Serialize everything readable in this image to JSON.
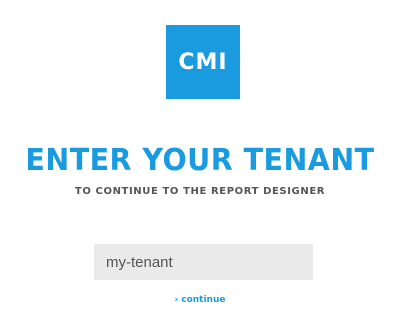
{
  "logo": {
    "text": "CMI",
    "background_color": "#1a9be0"
  },
  "heading": {
    "title": "ENTER YOUR TENANT",
    "subtitle": "TO CONTINUE TO THE REPORT DESIGNER"
  },
  "form": {
    "tenant_value": "my-tenant",
    "continue_prefix": "›",
    "continue_label": "continue"
  },
  "colors": {
    "accent": "#1a9be0",
    "subtitle_text": "#555555",
    "input_background": "#eaeaea"
  }
}
